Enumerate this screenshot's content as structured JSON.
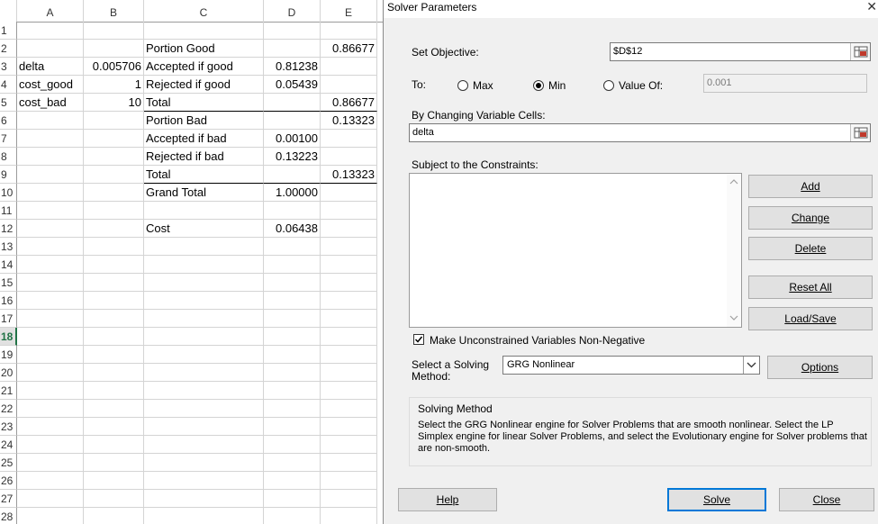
{
  "sheet": {
    "columns": [
      "A",
      "B",
      "C",
      "D",
      "E"
    ],
    "rows": [
      {
        "n": "1"
      },
      {
        "n": "2",
        "C": "Portion Good",
        "E": "0.86677"
      },
      {
        "n": "3",
        "A": "delta",
        "B": "0.005706",
        "C": "Accepted if good",
        "D": "0.81238"
      },
      {
        "n": "4",
        "A": "cost_good",
        "B": "1",
        "C": "Rejected if good",
        "D": "0.05439"
      },
      {
        "n": "5",
        "A": "cost_bad",
        "B": "10",
        "C": "Total",
        "E": "0.86677"
      },
      {
        "n": "6",
        "C": "Portion Bad",
        "E": "0.13323"
      },
      {
        "n": "7",
        "C": "Accepted if bad",
        "D": "0.00100"
      },
      {
        "n": "8",
        "C": "Rejected if bad",
        "D": "0.13223"
      },
      {
        "n": "9",
        "C": "Total",
        "E": "0.13323"
      },
      {
        "n": "10",
        "C": "Grand Total",
        "D": "1.00000"
      },
      {
        "n": "11"
      },
      {
        "n": "12",
        "C": "Cost",
        "D": "0.06438"
      },
      {
        "n": "13"
      },
      {
        "n": "14"
      },
      {
        "n": "15"
      },
      {
        "n": "16"
      },
      {
        "n": "17"
      },
      {
        "n": "18",
        "active": true
      },
      {
        "n": "19"
      },
      {
        "n": "20"
      },
      {
        "n": "21"
      },
      {
        "n": "22"
      },
      {
        "n": "23"
      },
      {
        "n": "24"
      },
      {
        "n": "25"
      },
      {
        "n": "26"
      },
      {
        "n": "27"
      },
      {
        "n": "28"
      }
    ]
  },
  "dialog": {
    "title": "Solver Parameters",
    "close_glyph": "✕",
    "set_objective_label": "Set Objective:",
    "objective_value": "$D$12",
    "to_label": "To:",
    "opt_max": "Max",
    "opt_min": "Min",
    "opt_value_of": "Value Of:",
    "selected_option": "Min",
    "value_of_field": "0.001",
    "changing_cells_label": "By Changing Variable Cells:",
    "changing_cells_value": "delta",
    "constraints_label": "Subject to the Constraints:",
    "btn_add": "Add",
    "btn_change": "Change",
    "btn_delete": "Delete",
    "btn_reset": "Reset All",
    "btn_loadsave": "Load/Save",
    "nonneg_label": "Make Unconstrained Variables Non-Negative",
    "nonneg_checked": true,
    "method_label_1": "Select a Solving",
    "method_label_2": "Method:",
    "method_value": "GRG Nonlinear",
    "btn_options": "Options",
    "solving_method_heading": "Solving Method",
    "solving_method_text": "Select the GRG Nonlinear engine for Solver Problems that are smooth nonlinear. Select the LP Simplex engine for linear Solver Problems, and select the Evolutionary engine for Solver problems that are non-smooth.",
    "btn_help": "Help",
    "btn_solve": "Solve",
    "btn_close": "Close"
  },
  "icons": {
    "ref": "collapse-dialog-icon",
    "scroll_up": "scroll-up-arrow-icon",
    "scroll_down": "scroll-down-arrow-icon",
    "dropdown": "chevron-down-icon"
  }
}
